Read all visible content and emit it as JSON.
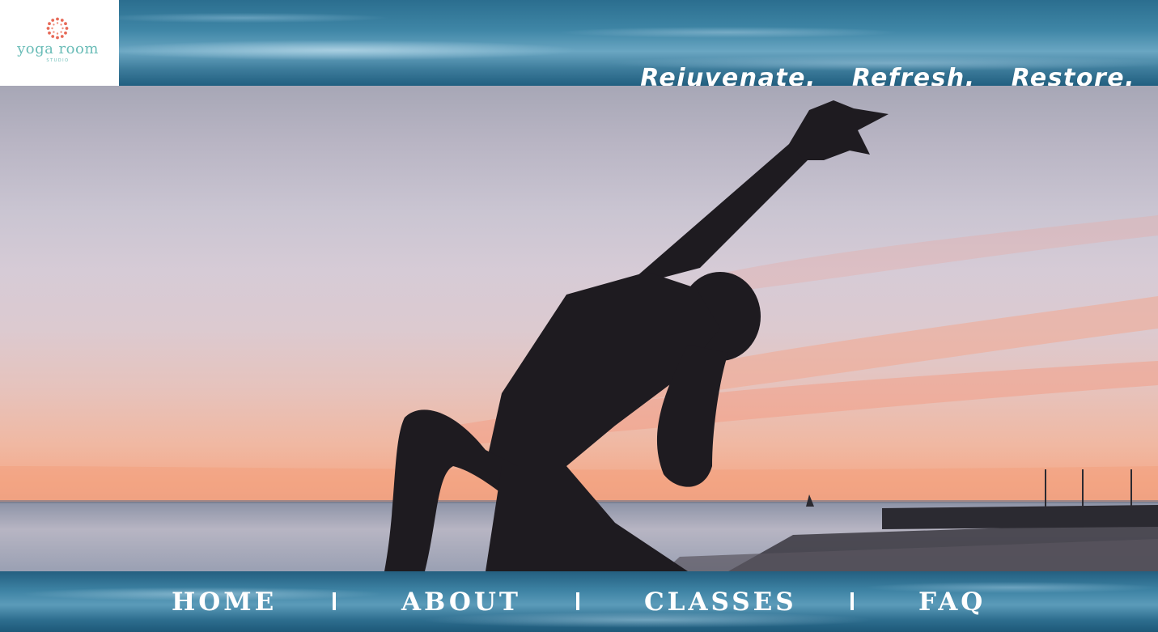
{
  "logo": {
    "name": "yoga  room",
    "sub": "STUDIO",
    "icon": "dotted-ring-icon",
    "colors": {
      "ring": "#e76a58",
      "text": "#6bbdb8"
    }
  },
  "tagline": {
    "words": [
      "Rejuvenate.",
      "Refresh.",
      "Restore."
    ]
  },
  "hero": {
    "image": "silhouette-yoga-pose-sunset-photo"
  },
  "nav": {
    "items": [
      {
        "label": "HOME"
      },
      {
        "label": "ABOUT"
      },
      {
        "label": "CLASSES"
      },
      {
        "label": "FAQ"
      }
    ]
  },
  "colors": {
    "band": "#3c81a2",
    "text": "#ffffff"
  }
}
